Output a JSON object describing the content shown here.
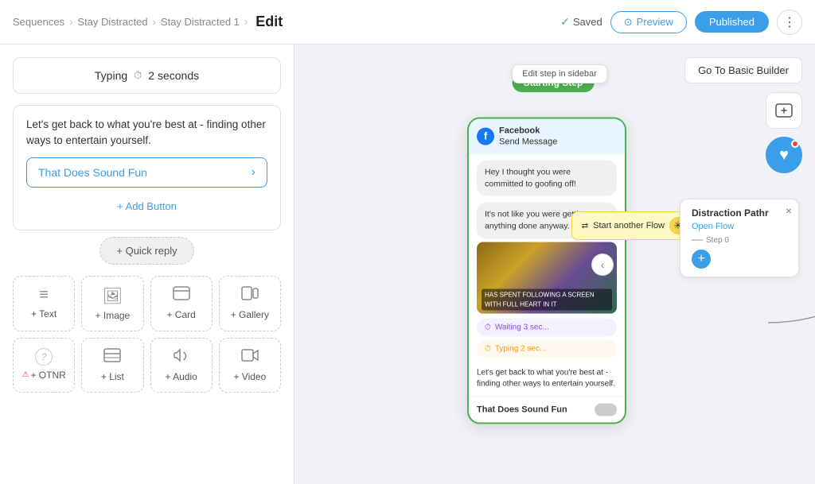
{
  "header": {
    "breadcrumb": [
      "Sequences",
      "Stay Distracted",
      "Stay Distracted 1"
    ],
    "edit_label": "Edit",
    "saved_label": "Saved",
    "preview_label": "Preview",
    "published_label": "Published"
  },
  "sidebar": {
    "typing_label": "Typing",
    "typing_duration": "2 seconds",
    "message_text": "Let's get back to what you're best at - finding other ways to entertain yourself.",
    "button_label": "That Does Sound Fun",
    "add_button_label": "+ Add Button",
    "quick_reply_label": "+ Quick reply",
    "add_items": [
      {
        "icon": "≡",
        "label": "+ Text"
      },
      {
        "icon": "🖼",
        "label": "+ Image"
      },
      {
        "icon": "▭",
        "label": "+ Card"
      },
      {
        "icon": "⊞",
        "label": "+ Gallery"
      },
      {
        "icon": "?",
        "label": "+ OTNR"
      },
      {
        "icon": "⊟",
        "label": "+ List"
      },
      {
        "icon": "🔊",
        "label": "+ Audio"
      },
      {
        "icon": "▷",
        "label": "+ Video"
      }
    ]
  },
  "canvas": {
    "edit_step_tooltip": "Edit step in sidebar",
    "starting_step_label": "Starting Step",
    "go_basic_btn": "Go To Basic Builder",
    "phone": {
      "fb_platform": "Facebook",
      "fb_action": "Send Message",
      "bubble1": "Hey I thought you were committed to goofing off!",
      "bubble2": "It's not like you were getting anything done anyway.",
      "gif_text": "HAS SPENT FOLLOWING A SCREEN WITH FULL HEART IN IT",
      "wait_label": "Waiting 3 sec...",
      "typing_label": "Typing 2 sec...",
      "bottom_message": "Let's get back to what you're best at - finding other ways to entertain yourself.",
      "that_btn": "That Does Sound Fun"
    },
    "start_another_flow": "Start another Flow",
    "distraction": {
      "title": "Distraction Pathr",
      "open_flow": "Open Flow",
      "step_label": "Step 0"
    }
  }
}
